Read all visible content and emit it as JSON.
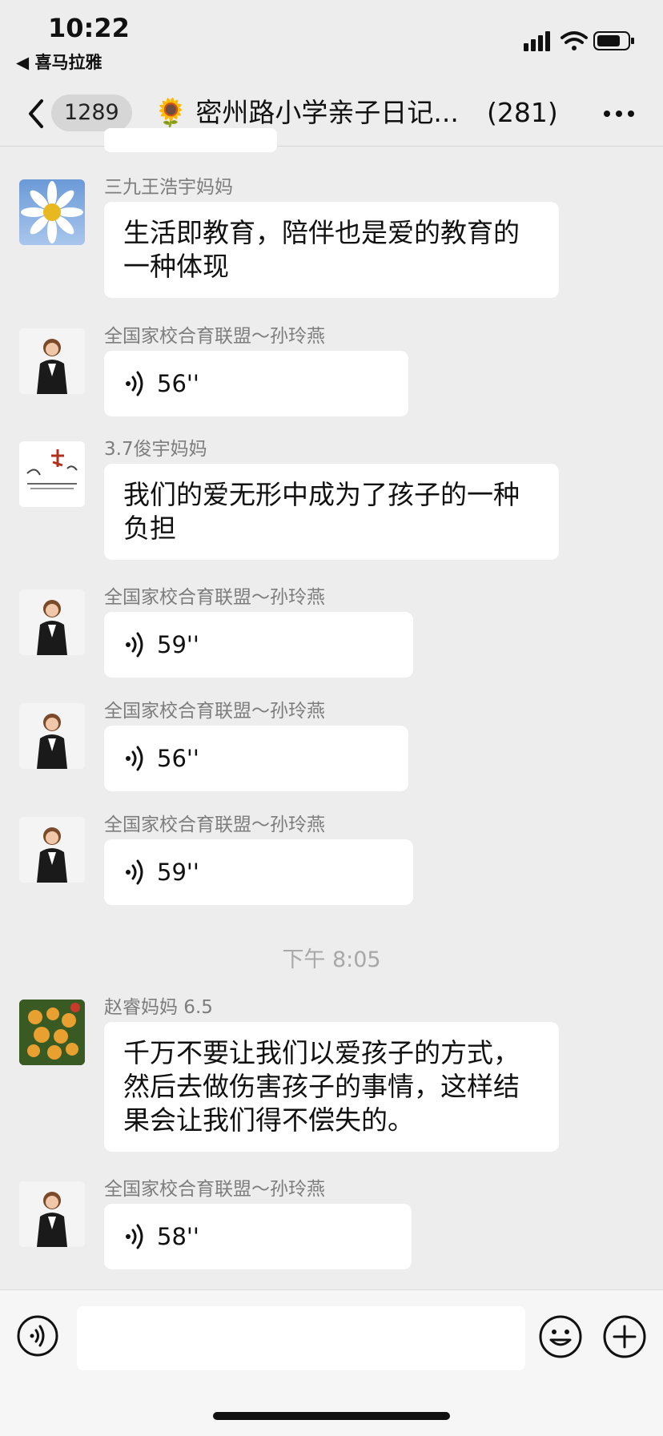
{
  "status_bar": {
    "time": "10:22",
    "back_app": "◀ 喜马拉雅"
  },
  "header": {
    "unread_count": "1289",
    "title": "密州路小学亲子日记...",
    "member_count": "(281)"
  },
  "messages": [
    {
      "sender": "三九王浩宇妈妈",
      "text": "生活即教育，陪伴也是爱的教育的一种体现"
    },
    {
      "sender": "全国家校合育联盟～孙玲燕",
      "duration": "56''"
    },
    {
      "sender": "3.7俊宇妈妈",
      "text": "我们的爱无形中成为了孩子的一种负担"
    },
    {
      "sender": "全国家校合育联盟～孙玲燕",
      "duration": "59''"
    },
    {
      "sender": "全国家校合育联盟～孙玲燕",
      "duration": "56''"
    },
    {
      "sender": "全国家校合育联盟～孙玲燕",
      "duration": "59''"
    },
    {
      "sender": "赵睿妈妈 6.5",
      "text": "千万不要让我们以爱孩子的方式，然后去做伤害孩子的事情，这样结果会让我们得不偿失的。"
    },
    {
      "sender": "全国家校合育联盟～孙玲燕",
      "duration": "58''"
    }
  ],
  "timestamp": "下午 8:05",
  "input": {
    "placeholder": ""
  },
  "colors": {
    "background": "#ededed",
    "bubble": "#ffffff",
    "meta_text": "#7d7d7d"
  }
}
